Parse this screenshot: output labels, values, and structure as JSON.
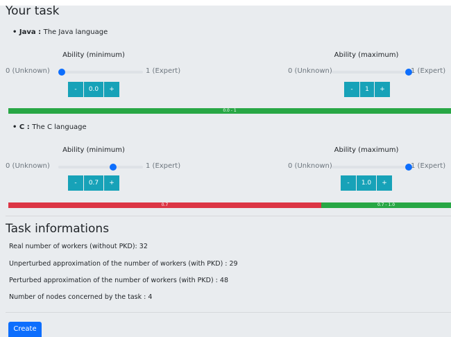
{
  "task_title": "Your task",
  "skills": [
    {
      "name": "Java",
      "sep": ":",
      "description": "The Java language",
      "min": {
        "title": "Ability (minimum)",
        "left_label": "0 (Unknown)",
        "right_label": "1 (Expert)",
        "value_text": "0.0",
        "level": 0.0
      },
      "max": {
        "title": "Ability (maximum)",
        "left_label": "0 (Unknown)",
        "right_label": "1 (Expert)",
        "value_text": "1",
        "level": 1.0
      },
      "bar": [
        {
          "label": "0.0 - 1",
          "color": "#28a745",
          "fraction": 1.0
        }
      ]
    },
    {
      "name": "C",
      "sep": ":",
      "description": "The C language",
      "min": {
        "title": "Ability (minimum)",
        "left_label": "0 (Unknown)",
        "right_label": "1 (Expert)",
        "value_text": "0.7",
        "level": 0.7
      },
      "max": {
        "title": "Ability (maximum)",
        "left_label": "0 (Unknown)",
        "right_label": "1 (Expert)",
        "value_text": "1.0",
        "level": 1.0
      },
      "bar": [
        {
          "label": "0.7",
          "color": "#dc3545",
          "fraction": 0.7
        },
        {
          "label": "0.7 - 1.0",
          "color": "#28a745",
          "fraction": 0.3
        }
      ]
    }
  ],
  "stepper": {
    "minus": "-",
    "plus": "+"
  },
  "info_title": "Task informations",
  "info_lines": [
    "Real number of workers (without PKD): 32",
    "Unperturbed approximation of the number of workers (with PKD) : 29",
    "Perturbed approximation of the number of workers (with PKD) : 48",
    "Number of nodes concerned by the task : 4"
  ],
  "create_label": "Create",
  "colors": {
    "accent": "#0d6efd",
    "stepper": "#17a2b8",
    "bar_green": "#28a745",
    "bar_red": "#dc3545"
  }
}
